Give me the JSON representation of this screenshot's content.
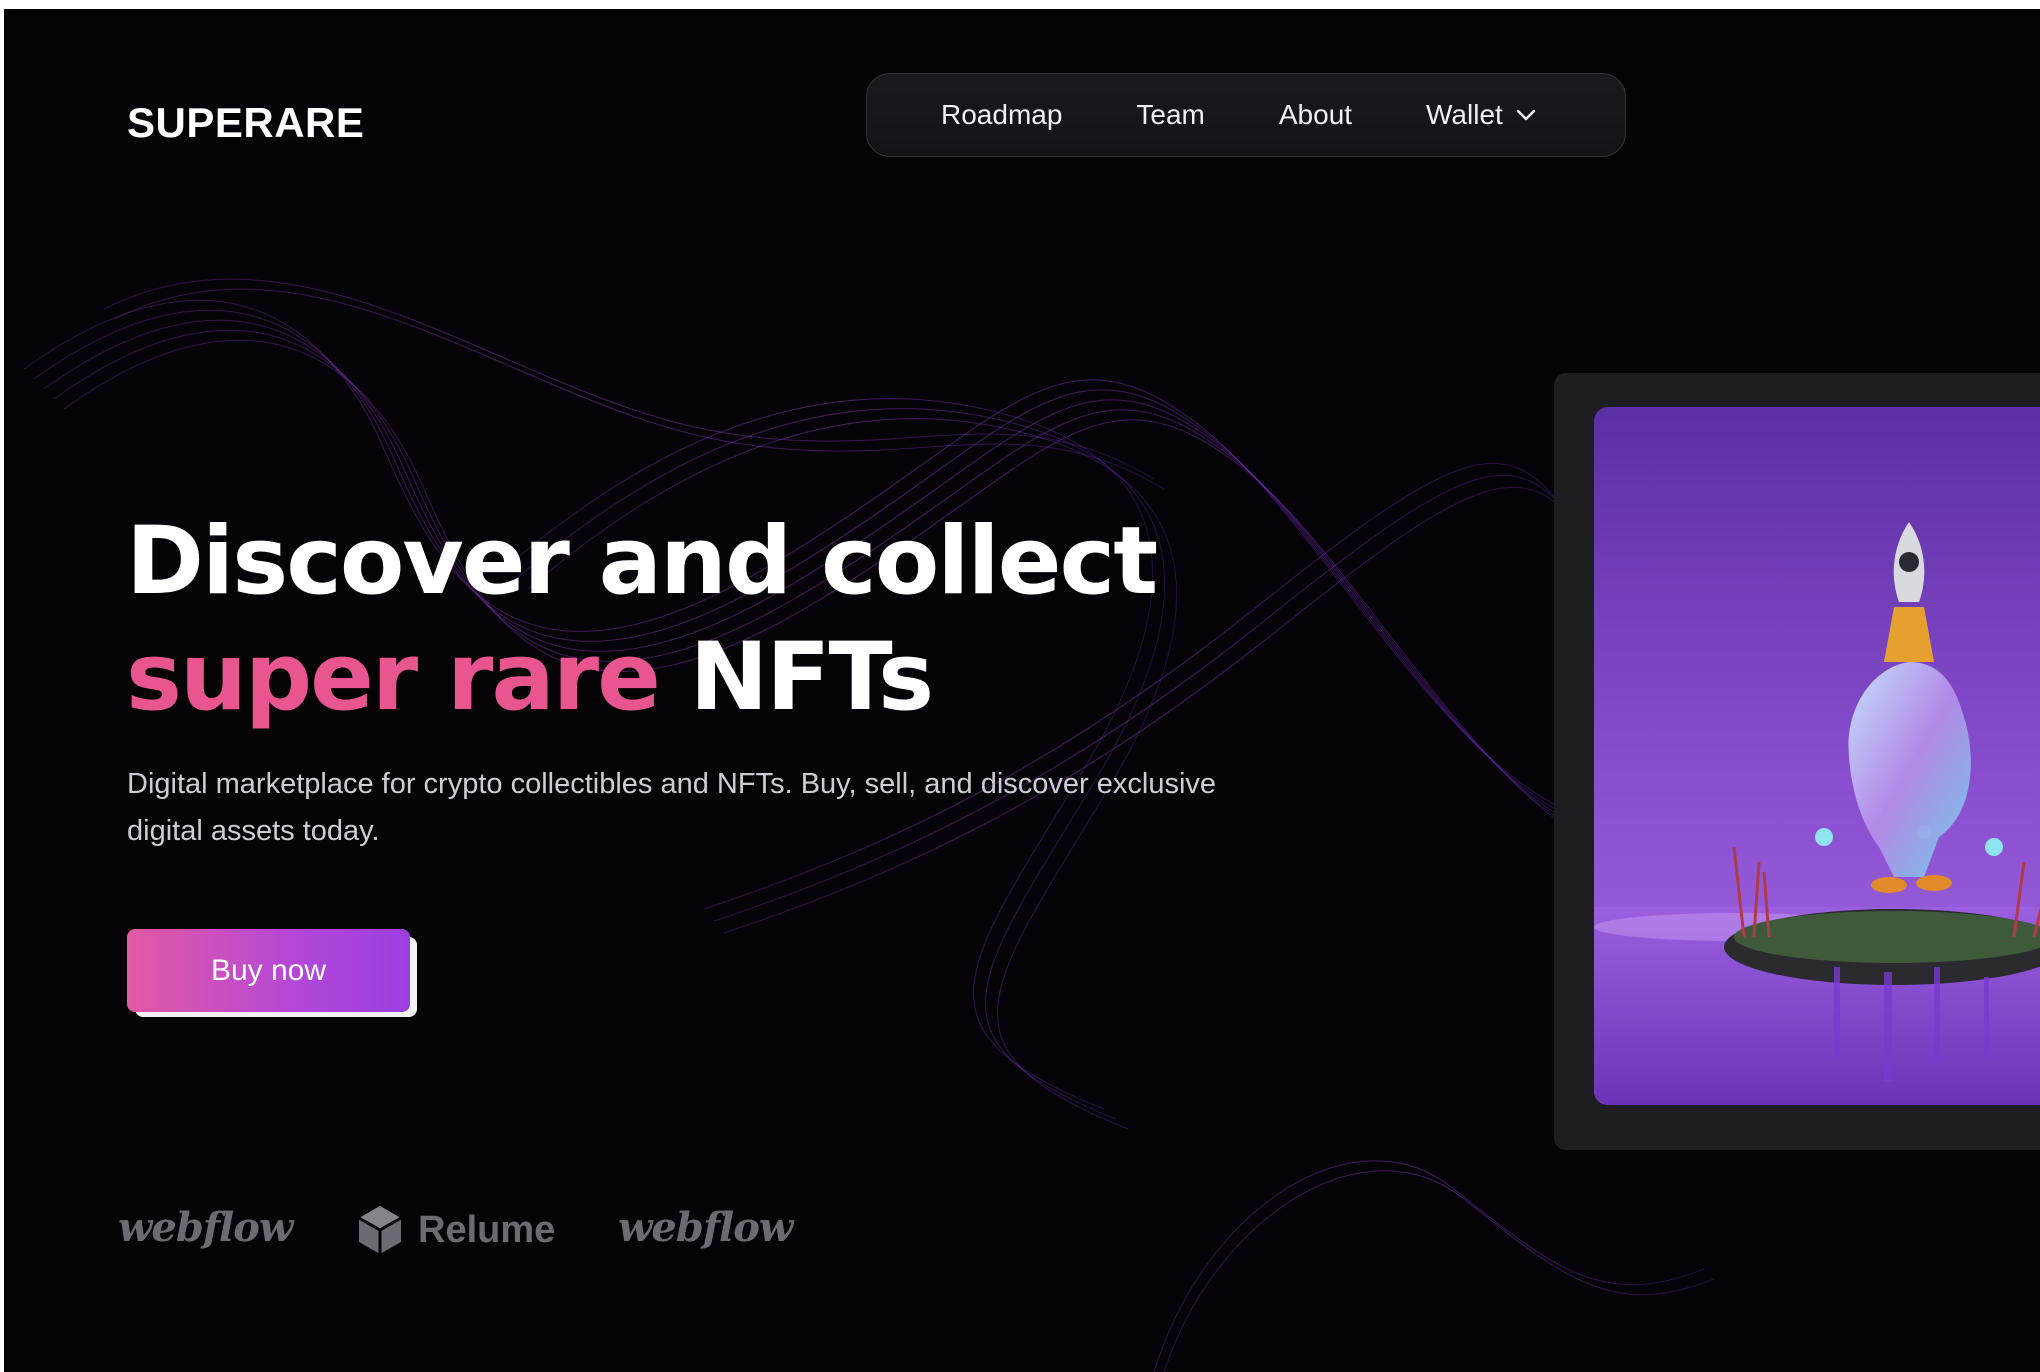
{
  "brand": {
    "logo": "SUPERARE"
  },
  "nav": {
    "items": [
      {
        "label": "Roadmap"
      },
      {
        "label": "Team"
      },
      {
        "label": "About"
      },
      {
        "label": "Wallet"
      }
    ]
  },
  "hero": {
    "headline_line1": "Discover and collect",
    "headline_highlight": "super rare",
    "headline_rest": "NFTs",
    "description": "Digital marketplace for crypto collectibles and NFTs. Buy, sell, and discover exclusive digital assets today.",
    "cta_label": "Buy now"
  },
  "partners": {
    "items": [
      {
        "name": "webflow"
      },
      {
        "name": "Relume"
      },
      {
        "name": "webflow"
      }
    ]
  },
  "colors": {
    "background": "#050308",
    "accent_pink": "#e8558f",
    "button_gradient_start": "#e35aa2",
    "button_gradient_end": "#9a3fe0",
    "nav_border": "#34323b"
  }
}
